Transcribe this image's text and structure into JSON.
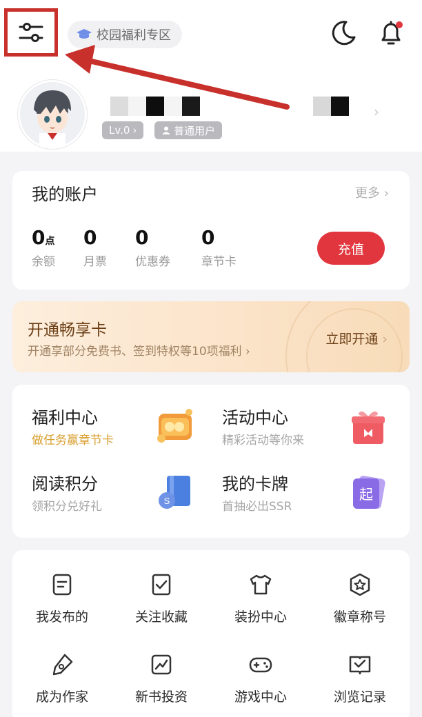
{
  "header": {
    "campus_label": "校园福利专区"
  },
  "profile": {
    "level": "Lv.0",
    "user_type": "普通用户"
  },
  "account": {
    "title": "我的账户",
    "more": "更多",
    "stats": [
      {
        "value": "0",
        "unit": "点",
        "label": "余额"
      },
      {
        "value": "0",
        "unit": "",
        "label": "月票"
      },
      {
        "value": "0",
        "unit": "",
        "label": "优惠券"
      },
      {
        "value": "0",
        "unit": "",
        "label": "章节卡"
      }
    ],
    "recharge": "充值"
  },
  "vip": {
    "title": "开通畅享卡",
    "desc": "开通享部分免费书、签到特权等10项福利",
    "cta": "立即开通"
  },
  "features": [
    {
      "title": "福利中心",
      "sub": "做任务赢章节卡",
      "icon": "wallet-icon",
      "sub_color": "#d9a030"
    },
    {
      "title": "活动中心",
      "sub": "精彩活动等你来",
      "icon": "gift-icon",
      "sub_color": "#a6a6a6"
    },
    {
      "title": "阅读积分",
      "sub": "领积分兑好礼",
      "icon": "book-coin-icon",
      "sub_color": "#a6a6a6"
    },
    {
      "title": "我的卡牌",
      "sub": "首抽必出SSR",
      "icon": "card-icon",
      "sub_color": "#a6a6a6"
    }
  ],
  "card_glyph": "起",
  "grid": [
    {
      "label": "我发布的",
      "icon": "document-icon"
    },
    {
      "label": "关注收藏",
      "icon": "bookmark-check-icon"
    },
    {
      "label": "装扮中心",
      "icon": "shirt-icon"
    },
    {
      "label": "徽章称号",
      "icon": "badge-star-icon"
    },
    {
      "label": "成为作家",
      "icon": "pen-icon"
    },
    {
      "label": "新书投资",
      "icon": "trend-chart-icon"
    },
    {
      "label": "游戏中心",
      "icon": "gamepad-icon"
    },
    {
      "label": "浏览记录",
      "icon": "book-history-icon"
    }
  ],
  "colors": {
    "accent": "#e2363e",
    "highlight_box": "#c8302c",
    "vip_text": "#6b3e16"
  }
}
